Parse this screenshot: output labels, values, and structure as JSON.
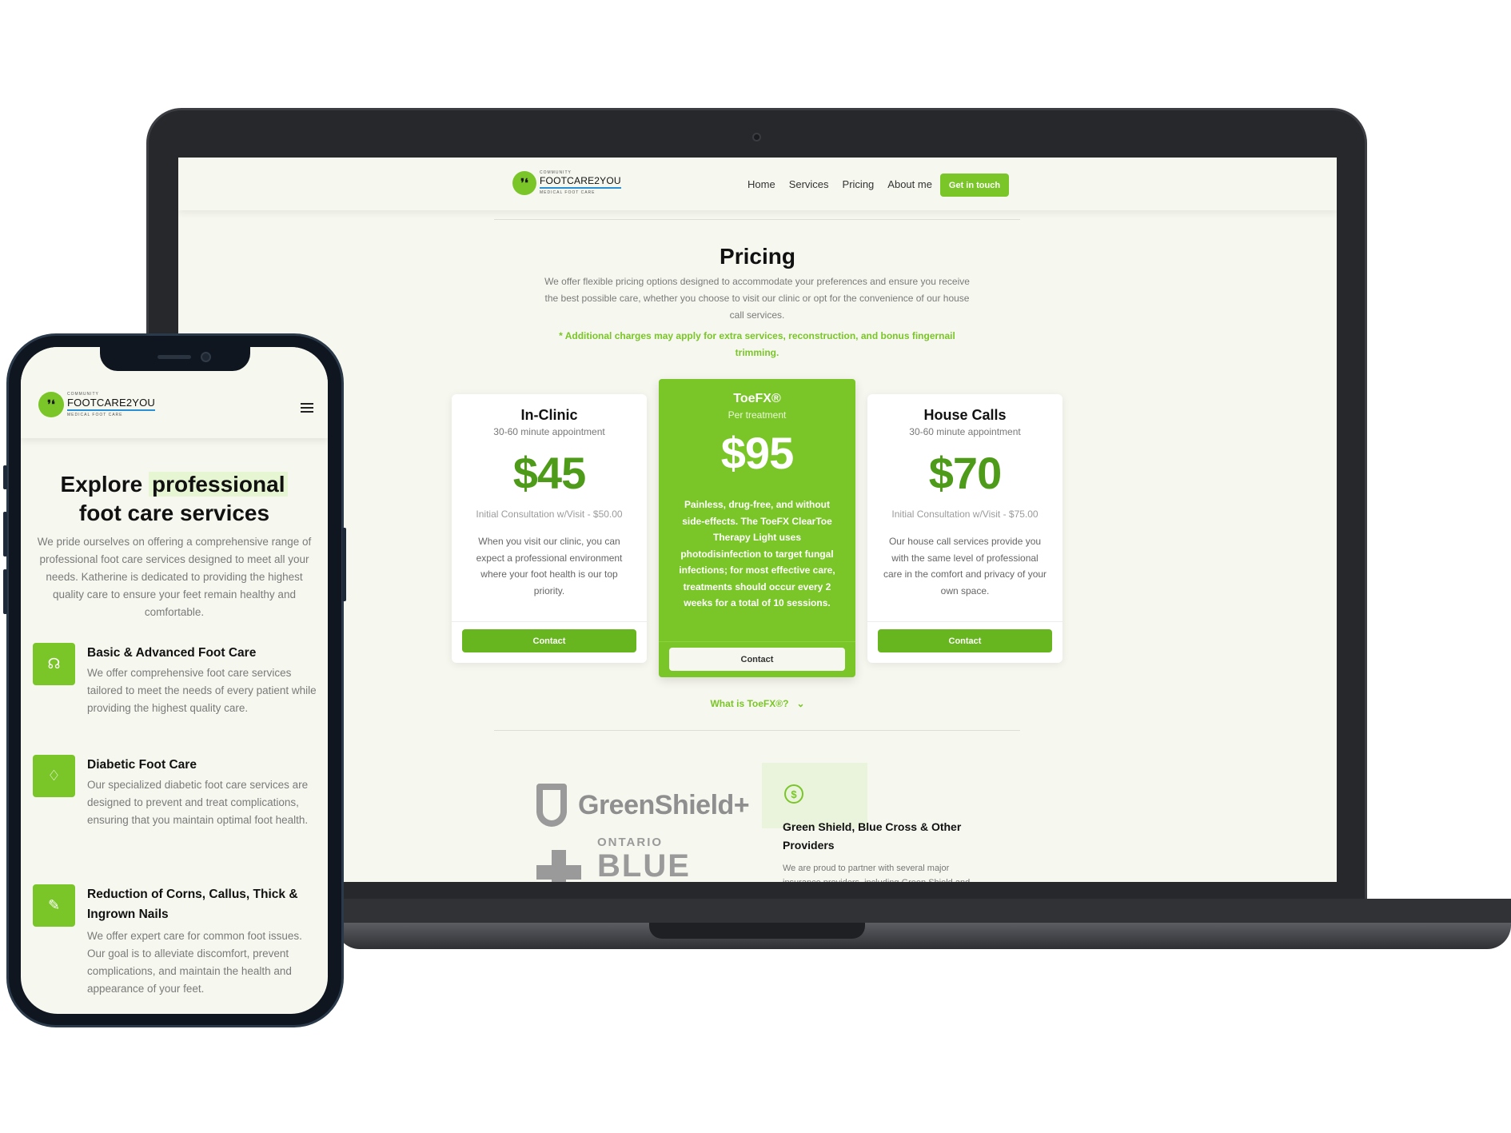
{
  "brand": {
    "logo_small": "COMMUNITY",
    "logo_main": "FOOTCARE2YOU",
    "logo_sub": "MEDICAL FOOT CARE",
    "accent": "#7ac628",
    "accent_dark": "#4e9b1a"
  },
  "desktop": {
    "nav": [
      "Home",
      "Services",
      "Pricing",
      "About me"
    ],
    "cta": "Get in touch",
    "pricing": {
      "title": "Pricing",
      "intro": "We offer flexible pricing options designed to accommodate your preferences and ensure you receive the best possible care, whether you choose to visit our clinic or opt for the convenience of our house call services.",
      "note": "* Additional charges may apply for extra services, reconstruction, and bonus fingernail trimming.",
      "plans": [
        {
          "title": "In-Clinic",
          "subtitle": "30-60 minute appointment",
          "price": "$45",
          "initial": "Initial Consultation w/Visit - $50.00",
          "description": "When you visit our clinic, you can expect a professional environment where your foot health is our top priority.",
          "button": "Contact"
        },
        {
          "title": "ToeFX®",
          "subtitle": "Per treatment",
          "price": "$95",
          "description": "Painless, drug-free, and without side-effects. The ToeFX ClearToe Therapy Light uses photodisinfection to target fungal infections; for most effective care, treatments should occur every 2 weeks for a total of 10 sessions.",
          "button": "Contact"
        },
        {
          "title": "House Calls",
          "subtitle": "30-60 minute appointment",
          "price": "$70",
          "initial": "Initial Consultation w/Visit - $75.00",
          "description": "Our house call services provide you with the same level of professional care in the comfort and privacy of your own space.",
          "button": "Contact"
        }
      ],
      "toefx_link": "What is ToeFX®?"
    },
    "insurance": {
      "greenshield": "GreenShield+",
      "bluecross_small": "ONTARIO",
      "bluecross_big": "BLUE CROSS",
      "title": "Green Shield, Blue Cross & Other Providers",
      "description": "We are proud to partner with several major insurance providers, including Green Shield and"
    }
  },
  "mobile": {
    "hero_pre": "Explore ",
    "hero_highlight": "professional",
    "hero_post": "foot care services",
    "intro": "We pride ourselves on offering a comprehensive range of professional foot care services designed to meet all your needs. Katherine is dedicated to providing the highest quality care to ensure your feet remain healthy and comfortable.",
    "services": [
      {
        "icon": "stethoscope-icon",
        "title": "Basic & Advanced Foot Care",
        "description": "We offer comprehensive foot care services tailored to meet the needs of every patient while providing the highest quality care."
      },
      {
        "icon": "droplet-icon",
        "title": "Diabetic Foot Care",
        "description": "Our specialized diabetic foot care services are designed to prevent and treat complications, ensuring that you maintain optimal foot health."
      },
      {
        "icon": "bandage-icon",
        "title": "Reduction of Corns, Callus, Thick & Ingrown Nails",
        "description": "We offer expert care for common foot issues. Our goal is to alleviate discomfort, prevent complications, and maintain the health and appearance of your feet."
      }
    ]
  }
}
